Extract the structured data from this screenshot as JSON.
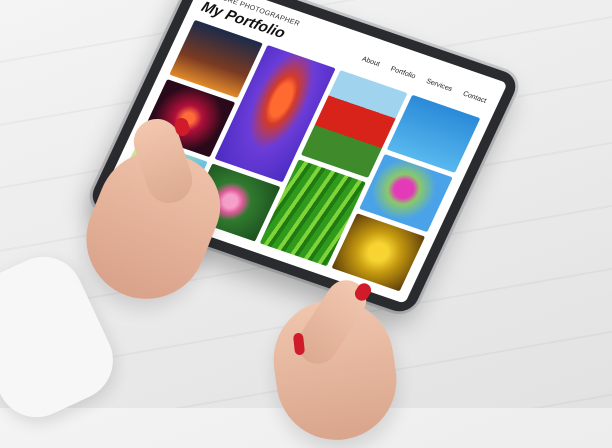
{
  "screen": {
    "kicker": "NATURE PHOTOGRAPHER",
    "title": "My Portfolio",
    "nav": [
      "About",
      "Portfolio",
      "Services",
      "Contact"
    ]
  }
}
